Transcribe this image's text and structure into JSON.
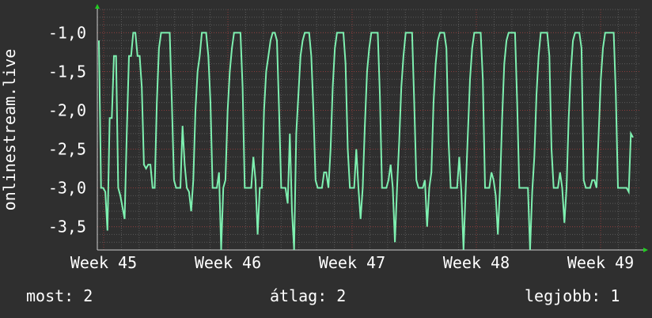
{
  "chart_data": {
    "type": "line",
    "ylabel": "onlinestream.live",
    "ylim": [
      -3.8,
      -0.7
    ],
    "yticks": [
      -1.0,
      -1.5,
      -2.0,
      -2.5,
      -3.0,
      -3.5
    ],
    "ytick_labels": [
      "-1,0",
      "-1,5",
      "-2,0",
      "-2,5",
      "-3,0",
      "-3,5"
    ],
    "xticks": [
      "Week 45",
      "Week 46",
      "Week 47",
      "Week 48",
      "Week 49"
    ],
    "grid": true,
    "line_color": "#7ef0b0",
    "series": [
      {
        "values": [
          -1.1,
          -3.0,
          -3.0,
          -3.05,
          -3.55,
          -2.1,
          -2.1,
          -1.3,
          -1.3,
          -3.0,
          -3.1,
          -3.25,
          -3.4,
          -2.3,
          -1.3,
          -1.3,
          -1.0,
          -1.0,
          -1.3,
          -1.3,
          -1.7,
          -2.7,
          -2.75,
          -2.7,
          -2.7,
          -3.0,
          -3.0,
          -1.9,
          -1.2,
          -1.0,
          -1.0,
          -1.0,
          -1.0,
          -1.0,
          -1.9,
          -2.9,
          -3.0,
          -3.0,
          -3.0,
          -2.2,
          -2.7,
          -3.0,
          -3.05,
          -3.3,
          -2.9,
          -2.0,
          -1.5,
          -1.3,
          -1.0,
          -1.0,
          -1.0,
          -1.3,
          -1.9,
          -3.0,
          -3.0,
          -3.0,
          -2.8,
          -3.8,
          -3.0,
          -2.9,
          -2.0,
          -1.5,
          -1.2,
          -1.0,
          -1.0,
          -1.0,
          -1.0,
          -1.7,
          -3.0,
          -3.0,
          -3.0,
          -3.0,
          -2.6,
          -2.9,
          -3.6,
          -3.0,
          -3.0,
          -2.0,
          -1.5,
          -1.3,
          -1.1,
          -1.0,
          -1.0,
          -1.1,
          -2.0,
          -3.0,
          -3.0,
          -3.0,
          -3.2,
          -2.3,
          -3.3,
          -3.8,
          -2.3,
          -1.8,
          -1.3,
          -1.1,
          -1.0,
          -1.0,
          -1.0,
          -1.3,
          -2.0,
          -2.9,
          -3.0,
          -3.0,
          -3.0,
          -2.8,
          -2.8,
          -3.0,
          -2.5,
          -1.7,
          -1.2,
          -1.0,
          -1.0,
          -1.0,
          -1.0,
          -1.4,
          -2.5,
          -3.0,
          -3.0,
          -3.0,
          -2.5,
          -3.0,
          -3.4,
          -3.0,
          -2.2,
          -1.5,
          -1.2,
          -1.0,
          -1.0,
          -1.0,
          -1.0,
          -1.8,
          -3.0,
          -3.0,
          -3.0,
          -2.9,
          -2.7,
          -3.0,
          -3.7,
          -3.0,
          -2.4,
          -1.7,
          -1.3,
          -1.0,
          -1.0,
          -1.0,
          -1.0,
          -1.9,
          -2.9,
          -3.0,
          -3.0,
          -3.0,
          -2.9,
          -3.5,
          -3.0,
          -2.8,
          -1.9,
          -1.4,
          -1.1,
          -1.0,
          -1.0,
          -1.0,
          -1.2,
          -2.4,
          -3.0,
          -3.0,
          -3.0,
          -3.0,
          -2.6,
          -3.05,
          -3.8,
          -3.0,
          -2.3,
          -1.6,
          -1.2,
          -1.0,
          -1.0,
          -1.0,
          -1.0,
          -1.6,
          -3.0,
          -3.0,
          -3.0,
          -2.8,
          -2.9,
          -3.1,
          -3.6,
          -3.0,
          -2.1,
          -1.4,
          -1.1,
          -1.0,
          -1.0,
          -1.0,
          -1.0,
          -1.9,
          -3.0,
          -3.0,
          -3.0,
          -3.0,
          -3.0,
          -3.8,
          -3.05,
          -2.6,
          -1.8,
          -1.3,
          -1.0,
          -1.0,
          -1.0,
          -1.0,
          -1.3,
          -2.5,
          -3.0,
          -3.0,
          -3.0,
          -2.8,
          -3.0,
          -3.45,
          -3.0,
          -2.1,
          -1.5,
          -1.1,
          -1.0,
          -1.0,
          -1.0,
          -1.2,
          -2.9,
          -3.0,
          -3.0,
          -3.0,
          -2.9,
          -2.9,
          -3.0,
          -2.3,
          -1.6,
          -1.2,
          -1.0,
          -1.0,
          -1.0,
          -1.0,
          -1.0,
          -1.8,
          -3.0,
          -3.0,
          -3.0,
          -3.0,
          -3.0,
          -3.05,
          -2.3,
          -2.35
        ]
      }
    ]
  },
  "footer": {
    "now": "most: 2",
    "avg": "átlag: 2",
    "best": "legjobb: 1"
  }
}
